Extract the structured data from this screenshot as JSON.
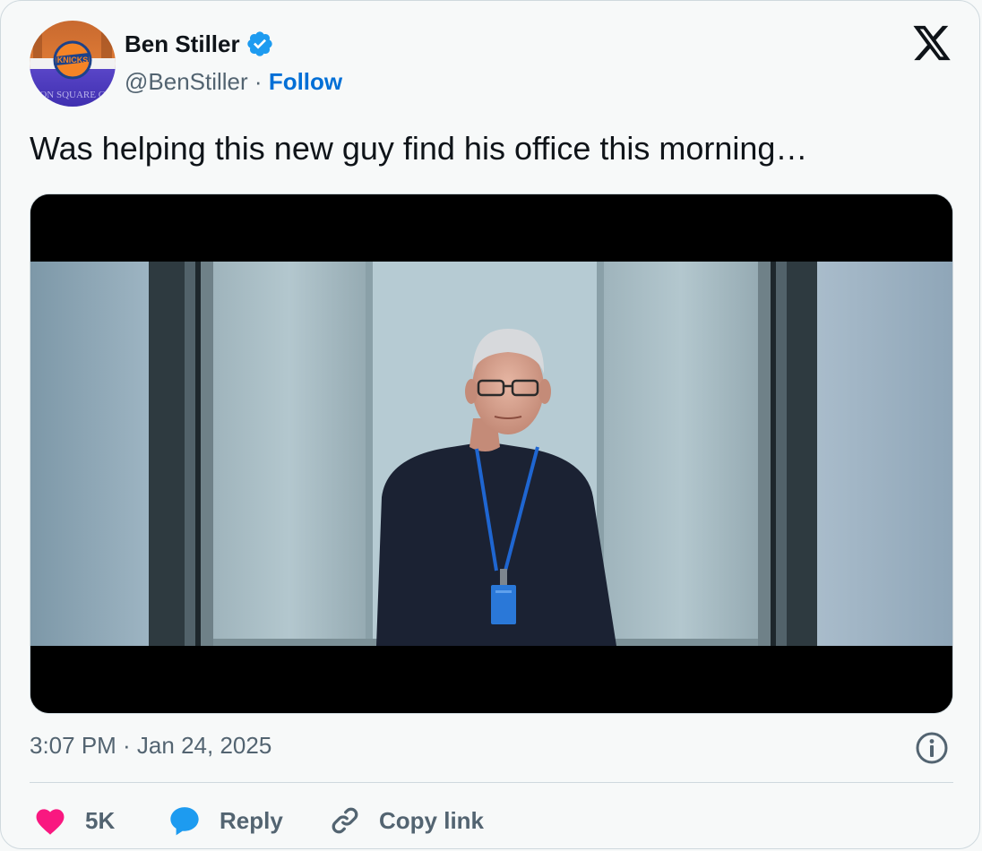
{
  "author": {
    "display_name": "Ben Stiller",
    "handle": "@BenStiller",
    "separator": "·",
    "follow_label": "Follow",
    "verified_color": "#1d9bf0",
    "avatar_text_top": "KNICKS",
    "avatar_text_bottom": "ON SQUARE G"
  },
  "tweet": {
    "text": "Was helping this new guy find his office this morning…",
    "timestamp": "3:07 PM · Jan 24, 2025",
    "media": {
      "type": "video-still"
    }
  },
  "actions": {
    "like_count": "5K",
    "reply_label": "Reply",
    "copy_label": "Copy link"
  },
  "colors": {
    "background": "#f7f9f9",
    "text_primary": "#0f1419",
    "text_secondary": "#536471",
    "link": "#006fd6",
    "like": "#f91880",
    "reply": "#1d9bf0",
    "border": "#cfd9de"
  },
  "icons": {
    "logo": "x-logo-icon",
    "verified": "verified-badge-icon",
    "info": "info-icon",
    "like": "heart-icon",
    "reply": "speech-bubble-icon",
    "copy": "link-icon"
  }
}
